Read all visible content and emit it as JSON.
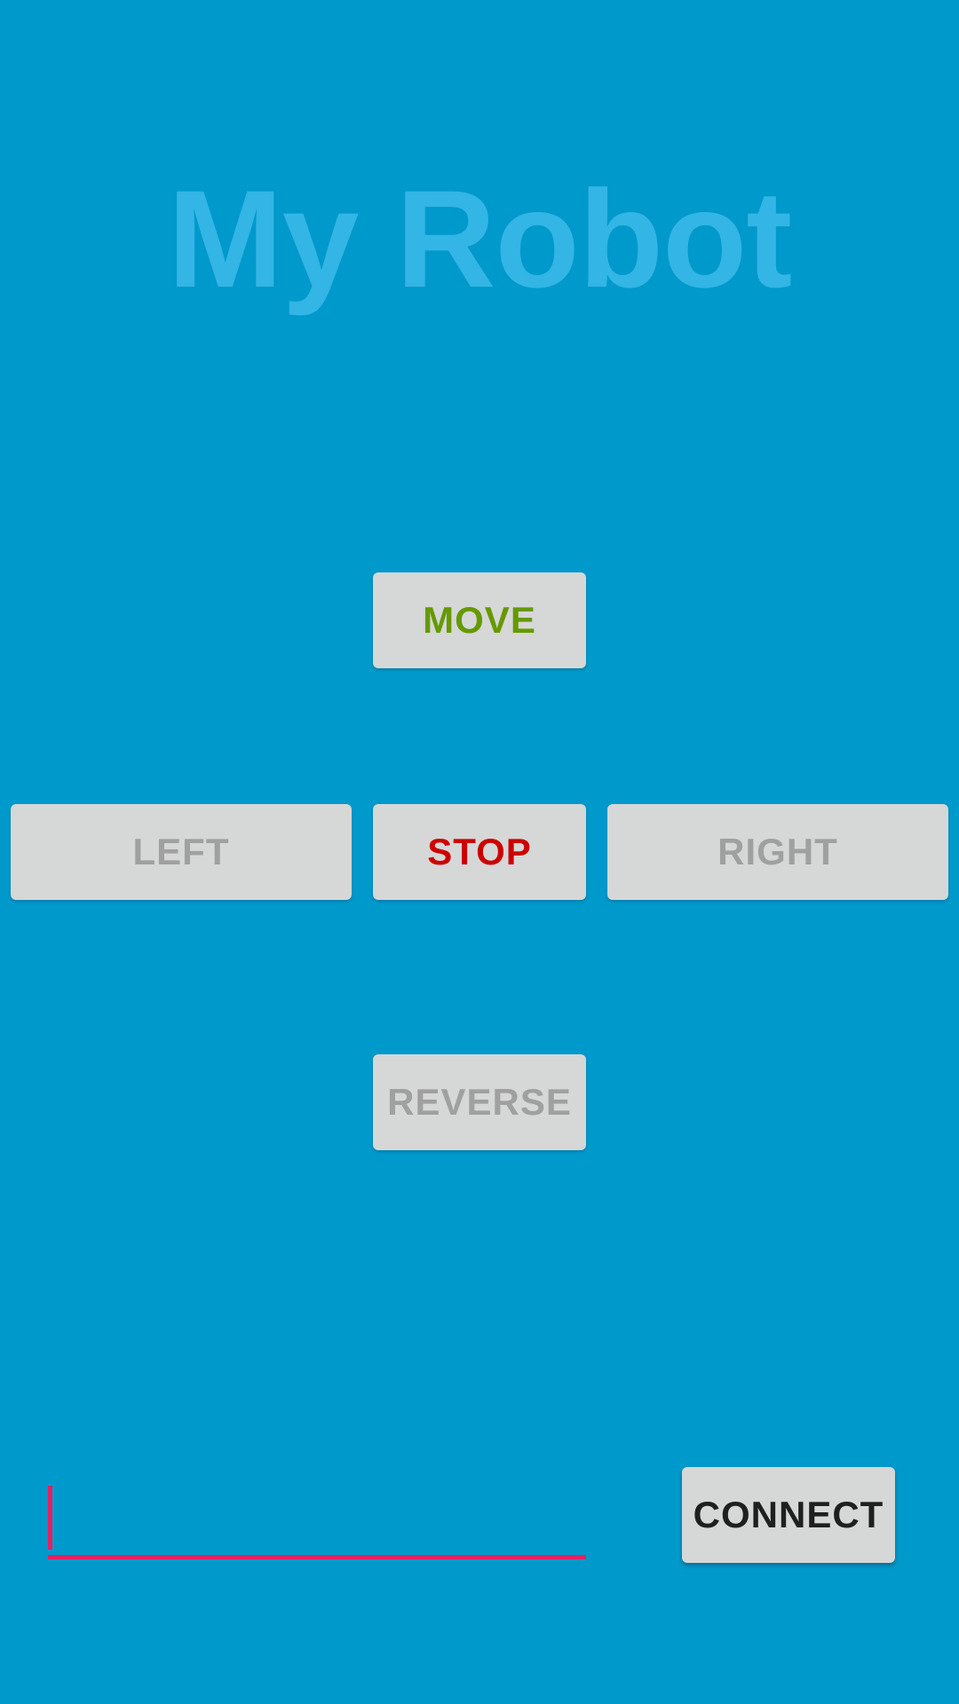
{
  "app": {
    "title": "My Robot",
    "title_color": "#33b5e5",
    "background_color": "#0099cc"
  },
  "controls": {
    "move_label": "MOVE",
    "move_color": "#669900",
    "left_label": "LEFT",
    "left_color": "#a0a0a0",
    "stop_label": "STOP",
    "stop_color": "#cc0000",
    "right_label": "RIGHT",
    "right_color": "#a0a0a0",
    "reverse_label": "REVERSE",
    "reverse_color": "#a0a0a0"
  },
  "connection": {
    "address_value": "",
    "address_placeholder": "",
    "focus_color": "#e91e63",
    "connect_label": "CONNECT",
    "connect_color": "#1f1f1f"
  }
}
